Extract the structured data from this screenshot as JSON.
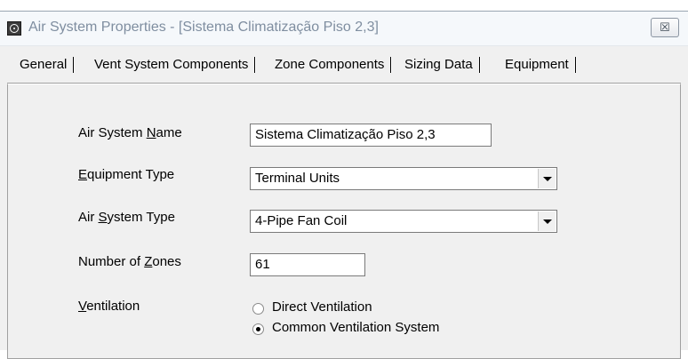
{
  "window": {
    "title": "Air System Properties - [Sistema Climatização Piso 2,3]",
    "close_glyph": "☒"
  },
  "tabs": [
    {
      "label": "General"
    },
    {
      "label": "Vent System Components"
    },
    {
      "label": "Zone Components"
    },
    {
      "label": "Sizing Data"
    },
    {
      "label": "Equipment"
    }
  ],
  "form": {
    "air_system_name": {
      "label_pre": "Air System ",
      "label_key": "N",
      "label_post": "ame",
      "value": "Sistema Climatização Piso 2,3"
    },
    "equipment_type": {
      "label_pre": "",
      "label_key": "E",
      "label_post": "quipment Type",
      "value": "Terminal Units"
    },
    "air_system_type": {
      "label_pre": "Air ",
      "label_key": "S",
      "label_post": "ystem Type",
      "value": "4-Pipe Fan Coil"
    },
    "number_of_zones": {
      "label_pre": "Number of ",
      "label_key": "Z",
      "label_post": "ones",
      "value": "61"
    },
    "ventilation": {
      "label_pre": "",
      "label_key": "V",
      "label_post": "entilation",
      "options": [
        {
          "label": "Direct Ventilation",
          "checked": false
        },
        {
          "label": "Common Ventilation System",
          "checked": true
        }
      ]
    }
  }
}
